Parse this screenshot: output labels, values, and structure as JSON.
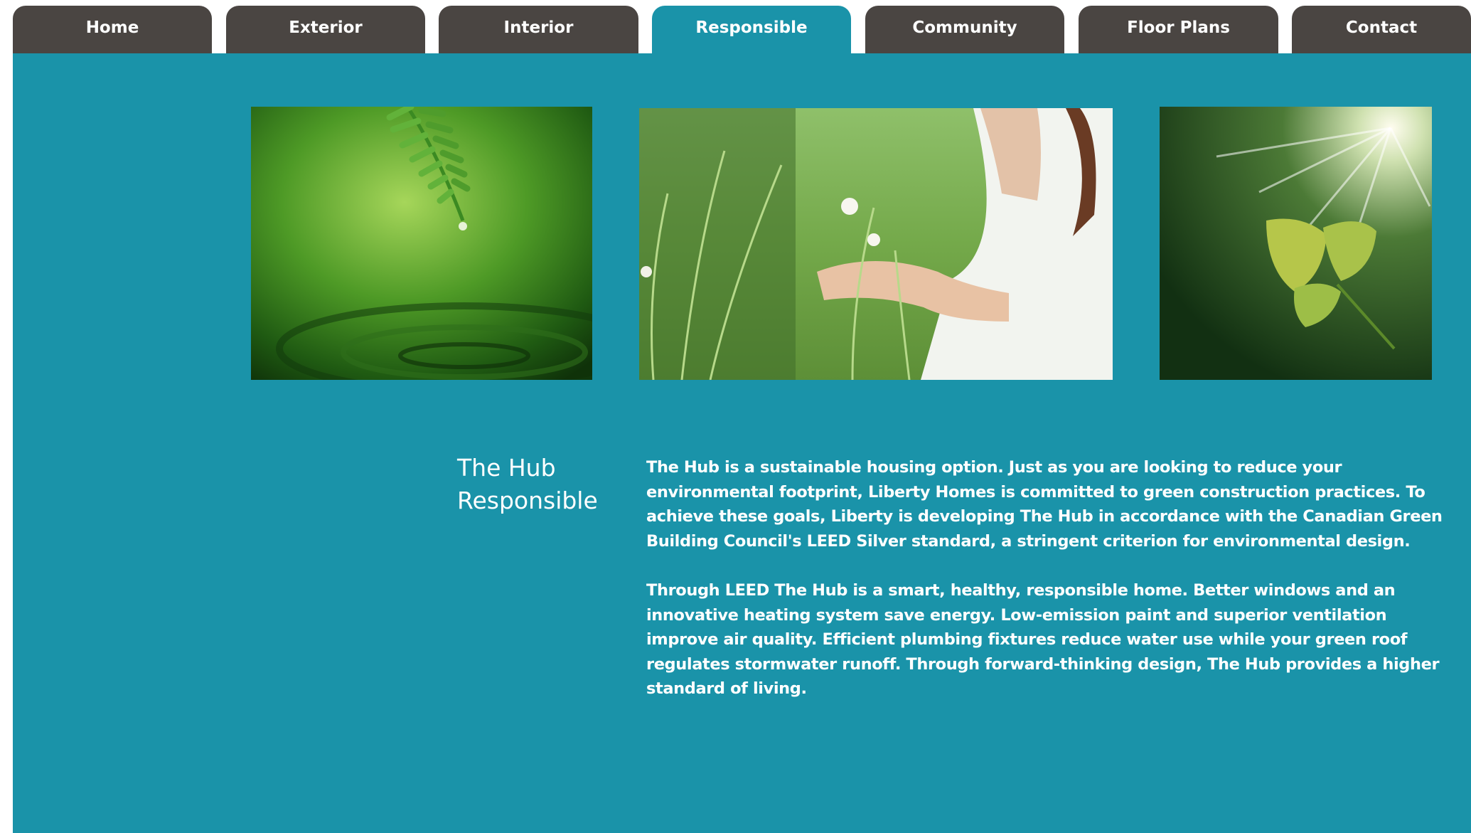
{
  "nav": {
    "tabs": [
      {
        "label": "Home"
      },
      {
        "label": "Exterior"
      },
      {
        "label": "Interior"
      },
      {
        "label": "Responsible",
        "active": true
      },
      {
        "label": "Community"
      },
      {
        "label": "Floor Plans"
      },
      {
        "label": "Contact"
      }
    ]
  },
  "content": {
    "heading_line1": "The Hub",
    "heading_line2": "Responsible",
    "paragraph1": "The Hub is a sustainable housing option. Just as you are looking to reduce your environmental footprint, Liberty Homes is committed to green construction practices. To achieve these goals, Liberty is developing The Hub in accordance with the Canadian Green Building Council's LEED Silver standard, a stringent criterion for environmental design.",
    "paragraph2": "Through LEED The Hub is a smart, healthy, responsible home. Better windows and an innovative heating system save energy. Low-emission paint and superior ventilation improve air quality. Efficient plumbing fixtures reduce water use while your green roof regulates stormwater runoff. Through forward-thinking design, The Hub provides a higher standard of living."
  },
  "images": [
    {
      "name": "fern-water-drop-photo"
    },
    {
      "name": "woman-in-grass-photo"
    },
    {
      "name": "sunlit-leaf-photo"
    }
  ],
  "colors": {
    "teal": "#1a93a9",
    "tab_dark": "#4a4542",
    "text": "#ffffff"
  }
}
